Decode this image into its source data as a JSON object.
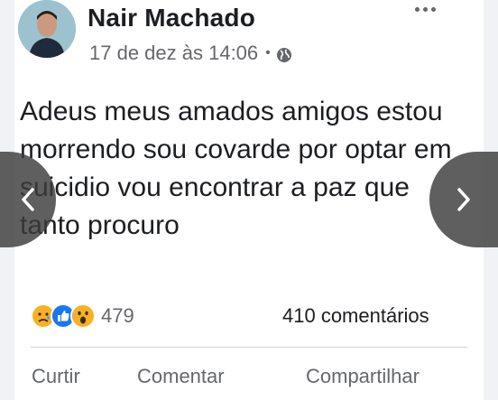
{
  "post": {
    "author": "Nair Machado",
    "timestamp": "17 de dez às 14:06",
    "privacy_separator": "•",
    "privacy_icon": "globe-icon",
    "text": "Adeus meus amados amigos estou morrendo sou covarde por optar em suicidio vou encontrar a paz que tanto procuro",
    "more_icon": "ellipsis-icon"
  },
  "reactions": {
    "icons": [
      "sad-icon",
      "like-icon",
      "wow-icon"
    ],
    "count": "479"
  },
  "comments": {
    "label": "410 comentários"
  },
  "actions": {
    "like": "Curtir",
    "comment": "Comentar",
    "share": "Compartilhar"
  },
  "colors": {
    "text": "#1c1e21",
    "secondary": "#65676b",
    "like_blue": "#1877f2",
    "emoji_yellow": "#f7b125"
  }
}
